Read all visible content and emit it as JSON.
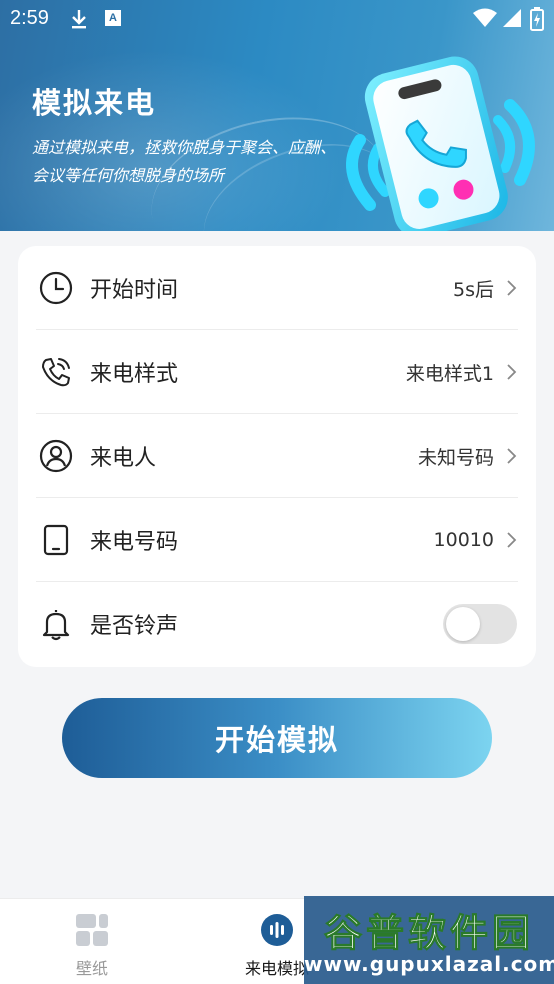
{
  "status_bar": {
    "time": "2:59",
    "notification_icons": [
      "download-icon",
      "a-icon"
    ],
    "system_icons": [
      "wifi-icon",
      "signal-icon",
      "battery-icon"
    ]
  },
  "hero": {
    "title": "模拟来电",
    "subtitle": "通过模拟来电，拯救你脱身于聚会、应酬、会议等任何你想脱身的场所"
  },
  "settings": {
    "rows": [
      {
        "icon": "clock-icon",
        "label": "开始时间",
        "value": "5s后"
      },
      {
        "icon": "phone-call-icon",
        "label": "来电样式",
        "value": "来电样式1"
      },
      {
        "icon": "user-icon",
        "label": "来电人",
        "value": "未知号码"
      },
      {
        "icon": "tablet-icon",
        "label": "来电号码",
        "value": "10010"
      },
      {
        "icon": "bell-icon",
        "label": "是否铃声",
        "toggle": false
      }
    ]
  },
  "start_button": {
    "label": "开始模拟"
  },
  "bottom_nav": {
    "items": [
      {
        "icon": "wallpaper-icon",
        "label": "壁纸",
        "active": false
      },
      {
        "icon": "call-sim-icon",
        "label": "来电模拟",
        "active": true
      }
    ]
  },
  "watermark": {
    "title": "谷普软件园",
    "url": "www.gupuxlazal.com"
  },
  "colors": {
    "accent": "#2c8ac3",
    "button_gradient_start": "#1e5d97",
    "button_gradient_end": "#7cd4f0",
    "background": "#f4f5f7"
  }
}
